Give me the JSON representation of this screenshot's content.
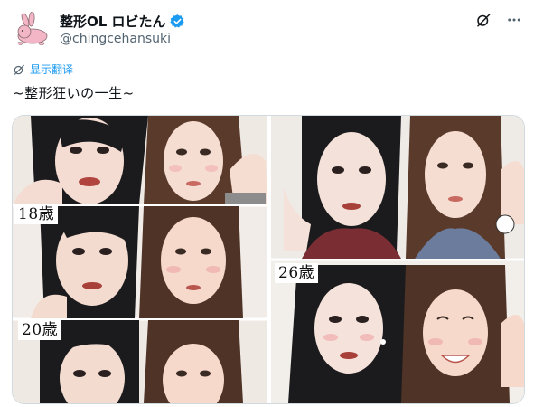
{
  "user": {
    "display_name": "整形OL ロビたん",
    "handle": "@chingcehansuki",
    "avatar_icon": "rabbit-icon",
    "verified_icon": "verified-badge-icon"
  },
  "actions": {
    "grok_icon": "grok-icon",
    "more_icon": "more-icon"
  },
  "translate": {
    "icon": "translate-icon",
    "label": "显示翻译"
  },
  "post": {
    "text": "~整形狂いの一生~"
  },
  "media": {
    "panels": [
      {
        "age_label": "18歳"
      },
      {
        "age_label": "20歳"
      },
      {
        "age_label": "26歳"
      }
    ]
  },
  "colors": {
    "accent": "#1d9bf0",
    "secondary_text": "#536471",
    "primary_text": "#0f1419",
    "border": "#cfd9de"
  }
}
